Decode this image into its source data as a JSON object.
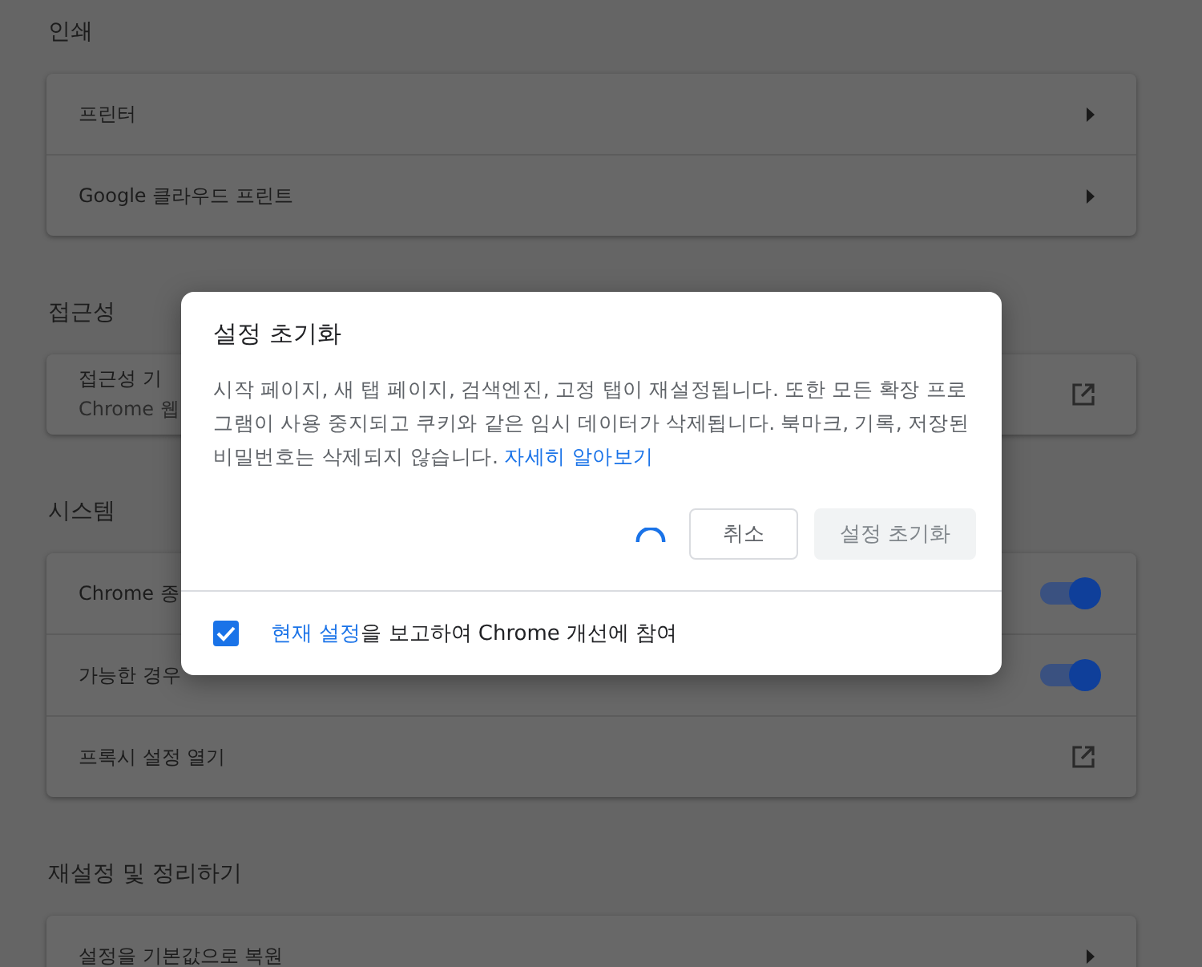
{
  "sections": [
    {
      "title": "인쇄",
      "items": [
        {
          "kind": "arrow",
          "label": "프린터"
        },
        {
          "kind": "arrow",
          "label": "Google 클라우드 프린트"
        }
      ]
    },
    {
      "title": "접근성",
      "items": [
        {
          "kind": "external",
          "label": "접근성 기",
          "sublabel": "Chrome 웹"
        }
      ]
    },
    {
      "title": "시스템",
      "items": [
        {
          "kind": "toggle",
          "label": "Chrome 종",
          "on": true
        },
        {
          "kind": "toggle",
          "label": "가능한 경우",
          "on": true
        },
        {
          "kind": "external",
          "label": "프록시 설정 열기"
        }
      ]
    },
    {
      "title": "재설정 및 정리하기",
      "items": [
        {
          "kind": "arrow",
          "label": "설정을 기본값으로 복원"
        }
      ]
    }
  ],
  "dialog": {
    "title": "설정 초기화",
    "body": "시작 페이지, 새 탭 페이지, 검색엔진, 고정 탭이 재설정됩니다. 또한 모든 확장 프로그램이 사용 중지되고 쿠키와 같은 임시 데이터가 삭제됩니다. 북마크, 기록, 저장된 비밀번호는 삭제되지 않습니다.",
    "link": "자세히 알아보기",
    "cancel": "취소",
    "confirm": "설정 초기화",
    "report": {
      "checked": true,
      "link": "현재 설정",
      "text": "을 보고하여 Chrome 개선에 참여"
    }
  }
}
